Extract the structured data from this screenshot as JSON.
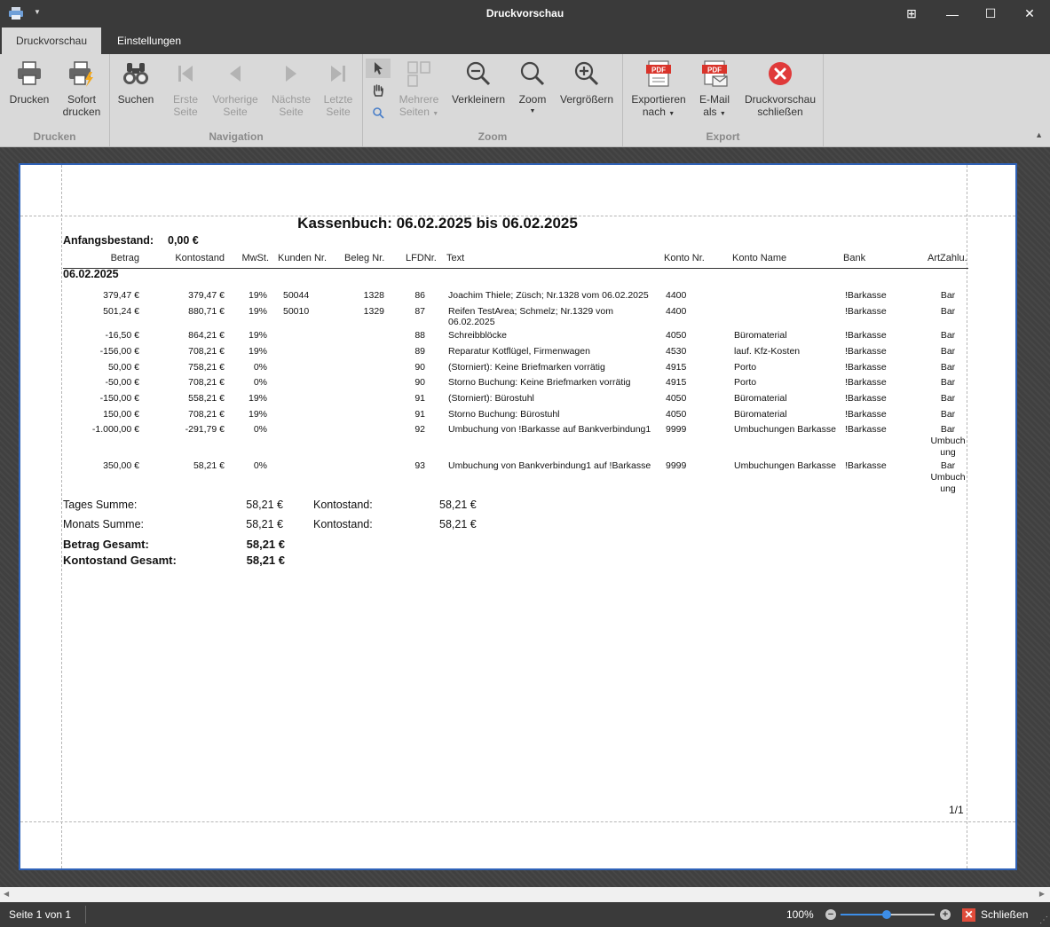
{
  "window": {
    "title": "Druckvorschau",
    "buttons": {
      "restore": "⊞",
      "minimize": "—",
      "maximize": "☐",
      "close": "✕"
    }
  },
  "tabs": [
    {
      "label": "Druckvorschau",
      "active": true
    },
    {
      "label": "Einstellungen",
      "active": false
    }
  ],
  "ribbon": {
    "groups": {
      "drucken": "Drucken",
      "navigation": "Navigation",
      "zoom": "Zoom",
      "export": "Export"
    },
    "buttons": {
      "drucken": [
        "Drucken",
        ""
      ],
      "sofort": [
        "Sofort",
        "drucken"
      ],
      "suchen": [
        "Suchen",
        ""
      ],
      "erste": [
        "Erste",
        "Seite"
      ],
      "vorherige": [
        "Vorherige",
        "Seite"
      ],
      "naechste": [
        "Nächste",
        "Seite"
      ],
      "letzte": [
        "Letzte",
        "Seite"
      ],
      "mehrere": [
        "Mehrere",
        "Seiten"
      ],
      "verkleinern": [
        "Verkleinern",
        ""
      ],
      "zoom": [
        "Zoom",
        ""
      ],
      "vergroessern": [
        "Vergrößern",
        ""
      ],
      "exportieren": [
        "Exportieren",
        "nach"
      ],
      "email": [
        "E-Mail",
        "als"
      ],
      "schliessen": [
        "Druckvorschau",
        "schließen"
      ]
    }
  },
  "report": {
    "title": "Kassenbuch:  06.02.2025  bis 06.02.2025",
    "opening_label": "Anfangsbestand:",
    "opening_value": "0,00 €",
    "columns": {
      "betrag": "Betrag",
      "kontostand": "Kontostand",
      "mwst": "MwSt.",
      "kunden": "Kunden Nr.",
      "beleg": "Beleg Nr.",
      "lfd": "LFDNr.",
      "text": "Text",
      "konto_nr": "Konto Nr.",
      "konto_name": "Konto Name",
      "bank": "Bank",
      "art": "ArtZahlu."
    },
    "date_group": "06.02.2025",
    "rows": [
      {
        "betrag": "379,47 €",
        "kontostand": "379,47 €",
        "mwst": "19%",
        "kunden": "50044",
        "beleg": "1328",
        "lfd": "86",
        "text": [
          "Joachim Thiele; Züsch; Nr.1328 vom 06.02.2025"
        ],
        "konto_nr": "4400",
        "konto_name": "",
        "bank": "!Barkasse",
        "art": [
          "Bar"
        ]
      },
      {
        "betrag": "501,24 €",
        "kontostand": "880,71 €",
        "mwst": "19%",
        "kunden": "50010",
        "beleg": "1329",
        "lfd": "87",
        "text": [
          "Reifen TestArea; Schmelz; Nr.1329 vom",
          "06.02.2025"
        ],
        "konto_nr": "4400",
        "konto_name": "",
        "bank": "!Barkasse",
        "art": [
          "Bar"
        ]
      },
      {
        "betrag": "-16,50 €",
        "kontostand": "864,21 €",
        "mwst": "19%",
        "kunden": "",
        "beleg": "",
        "lfd": "88",
        "text": [
          "Schreibblöcke"
        ],
        "konto_nr": "4050",
        "konto_name": "Büromaterial",
        "bank": "!Barkasse",
        "art": [
          "Bar"
        ]
      },
      {
        "betrag": "-156,00 €",
        "kontostand": "708,21 €",
        "mwst": "19%",
        "kunden": "",
        "beleg": "",
        "lfd": "89",
        "text": [
          "Reparatur Kotflügel, Firmenwagen"
        ],
        "konto_nr": "4530",
        "konto_name": "lauf. Kfz-Kosten",
        "bank": "!Barkasse",
        "art": [
          "Bar"
        ]
      },
      {
        "betrag": "50,00 €",
        "kontostand": "758,21 €",
        "mwst": "0%",
        "kunden": "",
        "beleg": "",
        "lfd": "90",
        "text": [
          "(Storniert): Keine Briefmarken vorrätig"
        ],
        "konto_nr": "4915",
        "konto_name": "Porto",
        "bank": "!Barkasse",
        "art": [
          "Bar"
        ]
      },
      {
        "betrag": "-50,00 €",
        "kontostand": "708,21 €",
        "mwst": "0%",
        "kunden": "",
        "beleg": "",
        "lfd": "90",
        "text": [
          "Storno Buchung: Keine Briefmarken vorrätig"
        ],
        "konto_nr": "4915",
        "konto_name": "Porto",
        "bank": "!Barkasse",
        "art": [
          "Bar"
        ]
      },
      {
        "betrag": "-150,00 €",
        "kontostand": "558,21 €",
        "mwst": "19%",
        "kunden": "",
        "beleg": "",
        "lfd": "91",
        "text": [
          "(Storniert): Bürostuhl"
        ],
        "konto_nr": "4050",
        "konto_name": "Büromaterial",
        "bank": "!Barkasse",
        "art": [
          "Bar"
        ]
      },
      {
        "betrag": "150,00 €",
        "kontostand": "708,21 €",
        "mwst": "19%",
        "kunden": "",
        "beleg": "",
        "lfd": "91",
        "text": [
          "Storno Buchung: Bürostuhl"
        ],
        "konto_nr": "4050",
        "konto_name": "Büromaterial",
        "bank": "!Barkasse",
        "art": [
          "Bar"
        ]
      },
      {
        "betrag": "-1.000,00 €",
        "kontostand": "-291,79 €",
        "mwst": "0%",
        "kunden": "",
        "beleg": "",
        "lfd": "92",
        "text": [
          "Umbuchung von !Barkasse auf Bankverbindung1"
        ],
        "konto_nr": "9999",
        "konto_name": "Umbuchungen Barkasse",
        "bank": "!Barkasse",
        "art": [
          "Bar",
          "Umbuch",
          "ung"
        ]
      },
      {
        "betrag": "350,00 €",
        "kontostand": "58,21 €",
        "mwst": "0%",
        "kunden": "",
        "beleg": "",
        "lfd": "93",
        "text": [
          "Umbuchung von Bankverbindung1 auf !Barkasse"
        ],
        "konto_nr": "9999",
        "konto_name": "Umbuchungen Barkasse",
        "bank": "!Barkasse",
        "art": [
          "Bar",
          "Umbuch",
          "ung"
        ]
      }
    ],
    "summary": {
      "tages_label": "Tages Summe:",
      "tages_value": "58,21 €",
      "tages_konto_label": "Kontostand:",
      "tages_konto_value": "58,21 €",
      "monats_label": "Monats Summe:",
      "monats_value": "58,21 €",
      "monats_konto_label": "Kontostand:",
      "monats_konto_value": "58,21 €",
      "betrag_label": "Betrag Gesamt:",
      "betrag_value": "58,21 €",
      "konto_label": "Kontostand Gesamt:",
      "konto_value": "58,21 €"
    },
    "page_number": "1/1"
  },
  "status": {
    "page_info": "Seite 1 von 1",
    "zoom": "100%",
    "zoom_fraction": 0.49,
    "close_label": "Schließen"
  }
}
